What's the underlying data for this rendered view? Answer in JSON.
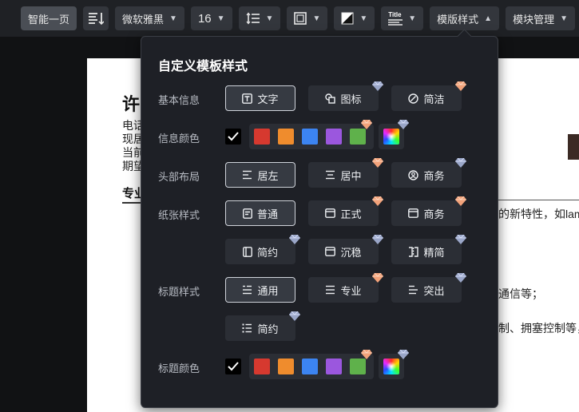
{
  "toolbar": {
    "smart_page": "智能一页",
    "font_family": "微软雅黑",
    "font_size": "16",
    "title_icon_text": "Title",
    "template_style": "模版样式",
    "module_manage": "模块管理"
  },
  "document": {
    "name": "许",
    "lines": [
      "电话",
      "现居",
      "当前",
      "期望"
    ],
    "section": "专业",
    "right_texts": [
      "的新特性，如lam",
      "通信等；",
      "制、拥塞控制等，"
    ]
  },
  "panel": {
    "title": "自定义模板样式",
    "sections": {
      "basic_info": {
        "label": "基本信息",
        "options": [
          {
            "label": "文字",
            "icon": "text-box-icon",
            "selected": true,
            "premium": false
          },
          {
            "label": "图标",
            "icon": "shapes-icon",
            "selected": false,
            "premium": true
          },
          {
            "label": "简洁",
            "icon": "circle-half-icon",
            "selected": false,
            "premium": true
          }
        ]
      },
      "info_color": {
        "label": "信息颜色",
        "colors": [
          "#d6392f",
          "#ef8c2d",
          "#3c84f1",
          "#9b57de",
          "#5fb14b"
        ]
      },
      "header_layout": {
        "label": "头部布局",
        "options": [
          {
            "label": "居左",
            "icon": "align-left-icon",
            "selected": true,
            "premium": false
          },
          {
            "label": "居中",
            "icon": "align-center-icon",
            "selected": false,
            "premium": true
          },
          {
            "label": "商务",
            "icon": "user-circle-icon",
            "selected": false,
            "premium": true
          }
        ]
      },
      "paper_style": {
        "label": "纸张样式",
        "options": [
          {
            "label": "普通",
            "icon": "doc-icon",
            "selected": true,
            "premium": false
          },
          {
            "label": "正式",
            "icon": "window-icon",
            "selected": false,
            "premium": true
          },
          {
            "label": "商务",
            "icon": "window-icon",
            "selected": false,
            "premium": true
          },
          {
            "label": "简约",
            "icon": "sidebar-icon",
            "selected": false,
            "premium": true
          },
          {
            "label": "沉稳",
            "icon": "window-icon",
            "selected": false,
            "premium": true
          },
          {
            "label": "精简",
            "icon": "split-icon",
            "selected": false,
            "premium": true
          }
        ]
      },
      "title_style": {
        "label": "标题样式",
        "options": [
          {
            "label": "通用",
            "icon": "list-lines-icon",
            "selected": true,
            "premium": false
          },
          {
            "label": "专业",
            "icon": "list-lines-icon",
            "selected": false,
            "premium": true
          },
          {
            "label": "突出",
            "icon": "list-lines-icon",
            "selected": false,
            "premium": true
          },
          {
            "label": "简约",
            "icon": "bullet-list-icon",
            "selected": false,
            "premium": true
          }
        ]
      },
      "title_color": {
        "label": "标题颜色",
        "colors": [
          "#d6392f",
          "#ef8c2d",
          "#3c84f1",
          "#9b57de",
          "#5fb14b"
        ]
      }
    }
  }
}
